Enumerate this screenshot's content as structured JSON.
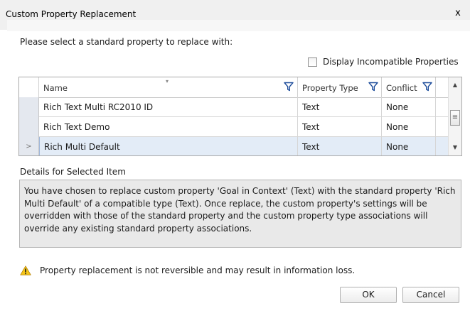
{
  "dialog": {
    "title": "Custom Property Replacement",
    "close_glyph": "x",
    "instruction": "Please select a standard property to replace with:",
    "show_incompatible_label": "Display Incompatible Properties",
    "show_incompatible_checked": false
  },
  "grid": {
    "columns": [
      {
        "label": "Name",
        "filter_icon": "filter-icon"
      },
      {
        "label": "Property Type",
        "filter_icon": "filter-icon"
      },
      {
        "label": "Conflict",
        "filter_icon": "filter-icon"
      }
    ],
    "rows": [
      {
        "name": "Rich Text Multi RC2010 ID",
        "type": "Text",
        "conflict": "None",
        "selected": false
      },
      {
        "name": "Rich Text Demo",
        "type": "Text",
        "conflict": "None",
        "selected": false
      },
      {
        "name": "Rich Multi Default",
        "type": "Text",
        "conflict": "None",
        "selected": true
      }
    ],
    "selected_row_marker": ">"
  },
  "details": {
    "label": "Details for Selected Item",
    "text": "You have chosen to replace custom property 'Goal in Context' (Text) with the standard property 'Rich Multi Default' of a compatible type (Text). Once replace, the custom property's settings will be overridden with those of the standard property and the custom property type associations will override any existing standard property associations."
  },
  "warning": {
    "icon": "warning-icon",
    "text": "Property replacement is not reversible and may result in information loss."
  },
  "buttons": {
    "ok": "OK",
    "cancel": "Cancel"
  },
  "colors": {
    "selected_row": "#e3ecf7",
    "details_bg": "#e9e9e9",
    "filter_icon": "#1f4e9c",
    "warning_fill": "#f5c518"
  }
}
